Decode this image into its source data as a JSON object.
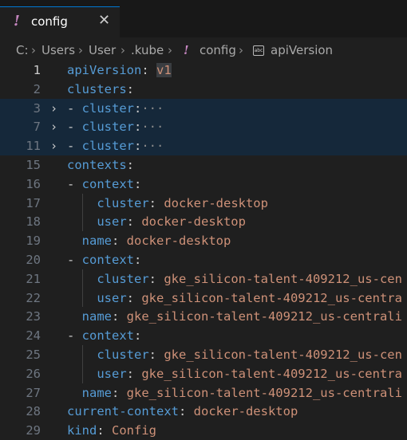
{
  "tab": {
    "icon": "yaml-bang-icon",
    "label": "config",
    "close": "✕"
  },
  "breadcrumb": {
    "drive": "C:",
    "users": "Users",
    "user": "User",
    "kube": ".kube",
    "file": "config",
    "symbol": "apiVersion",
    "abc_text": "abc",
    "separator": "›",
    "bang": "!"
  },
  "lines": [
    {
      "n": "1",
      "indent": "",
      "dash": "",
      "key": "apiVersion",
      "colon": ":",
      "value": "v1"
    },
    {
      "n": "2",
      "indent": "",
      "dash": "",
      "key": "clusters",
      "colon": ":",
      "value": ""
    },
    {
      "n": "3",
      "indent": "",
      "dash": "- ",
      "key": "cluster",
      "colon": ":",
      "value": "",
      "ellipsis": "···"
    },
    {
      "n": "7",
      "indent": "",
      "dash": "- ",
      "key": "cluster",
      "colon": ":",
      "value": "",
      "ellipsis": "···"
    },
    {
      "n": "11",
      "indent": "",
      "dash": "- ",
      "key": "cluster",
      "colon": ":",
      "value": "",
      "ellipsis": "···"
    },
    {
      "n": "15",
      "indent": "",
      "dash": "",
      "key": "contexts",
      "colon": ":",
      "value": ""
    },
    {
      "n": "16",
      "indent": "",
      "dash": "- ",
      "key": "context",
      "colon": ":",
      "value": ""
    },
    {
      "n": "17",
      "indent": "    ",
      "dash": "",
      "key": "cluster",
      "colon": ": ",
      "value": "docker-desktop"
    },
    {
      "n": "18",
      "indent": "    ",
      "dash": "",
      "key": "user",
      "colon": ": ",
      "value": "docker-desktop"
    },
    {
      "n": "19",
      "indent": "  ",
      "dash": "",
      "key": "name",
      "colon": ": ",
      "value": "docker-desktop"
    },
    {
      "n": "20",
      "indent": "",
      "dash": "- ",
      "key": "context",
      "colon": ":",
      "value": ""
    },
    {
      "n": "21",
      "indent": "    ",
      "dash": "",
      "key": "cluster",
      "colon": ": ",
      "value": "gke_silicon-talent-409212_us-cen"
    },
    {
      "n": "22",
      "indent": "    ",
      "dash": "",
      "key": "user",
      "colon": ": ",
      "value": "gke_silicon-talent-409212_us-centra"
    },
    {
      "n": "23",
      "indent": "  ",
      "dash": "",
      "key": "name",
      "colon": ": ",
      "value": "gke_silicon-talent-409212_us-centrali"
    },
    {
      "n": "24",
      "indent": "",
      "dash": "- ",
      "key": "context",
      "colon": ":",
      "value": ""
    },
    {
      "n": "25",
      "indent": "    ",
      "dash": "",
      "key": "cluster",
      "colon": ": ",
      "value": "gke_silicon-talent-409212_us-cen"
    },
    {
      "n": "26",
      "indent": "    ",
      "dash": "",
      "key": "user",
      "colon": ": ",
      "value": "gke_silicon-talent-409212_us-centra"
    },
    {
      "n": "27",
      "indent": "  ",
      "dash": "",
      "key": "name",
      "colon": ": ",
      "value": "gke_silicon-talent-409212_us-centrali"
    },
    {
      "n": "28",
      "indent": "",
      "dash": "",
      "key": "current-context",
      "colon": ": ",
      "value": "docker-desktop"
    },
    {
      "n": "29",
      "indent": "",
      "dash": "",
      "key": "kind",
      "colon": ": ",
      "value": "Config"
    }
  ],
  "fold_chevron": "›"
}
